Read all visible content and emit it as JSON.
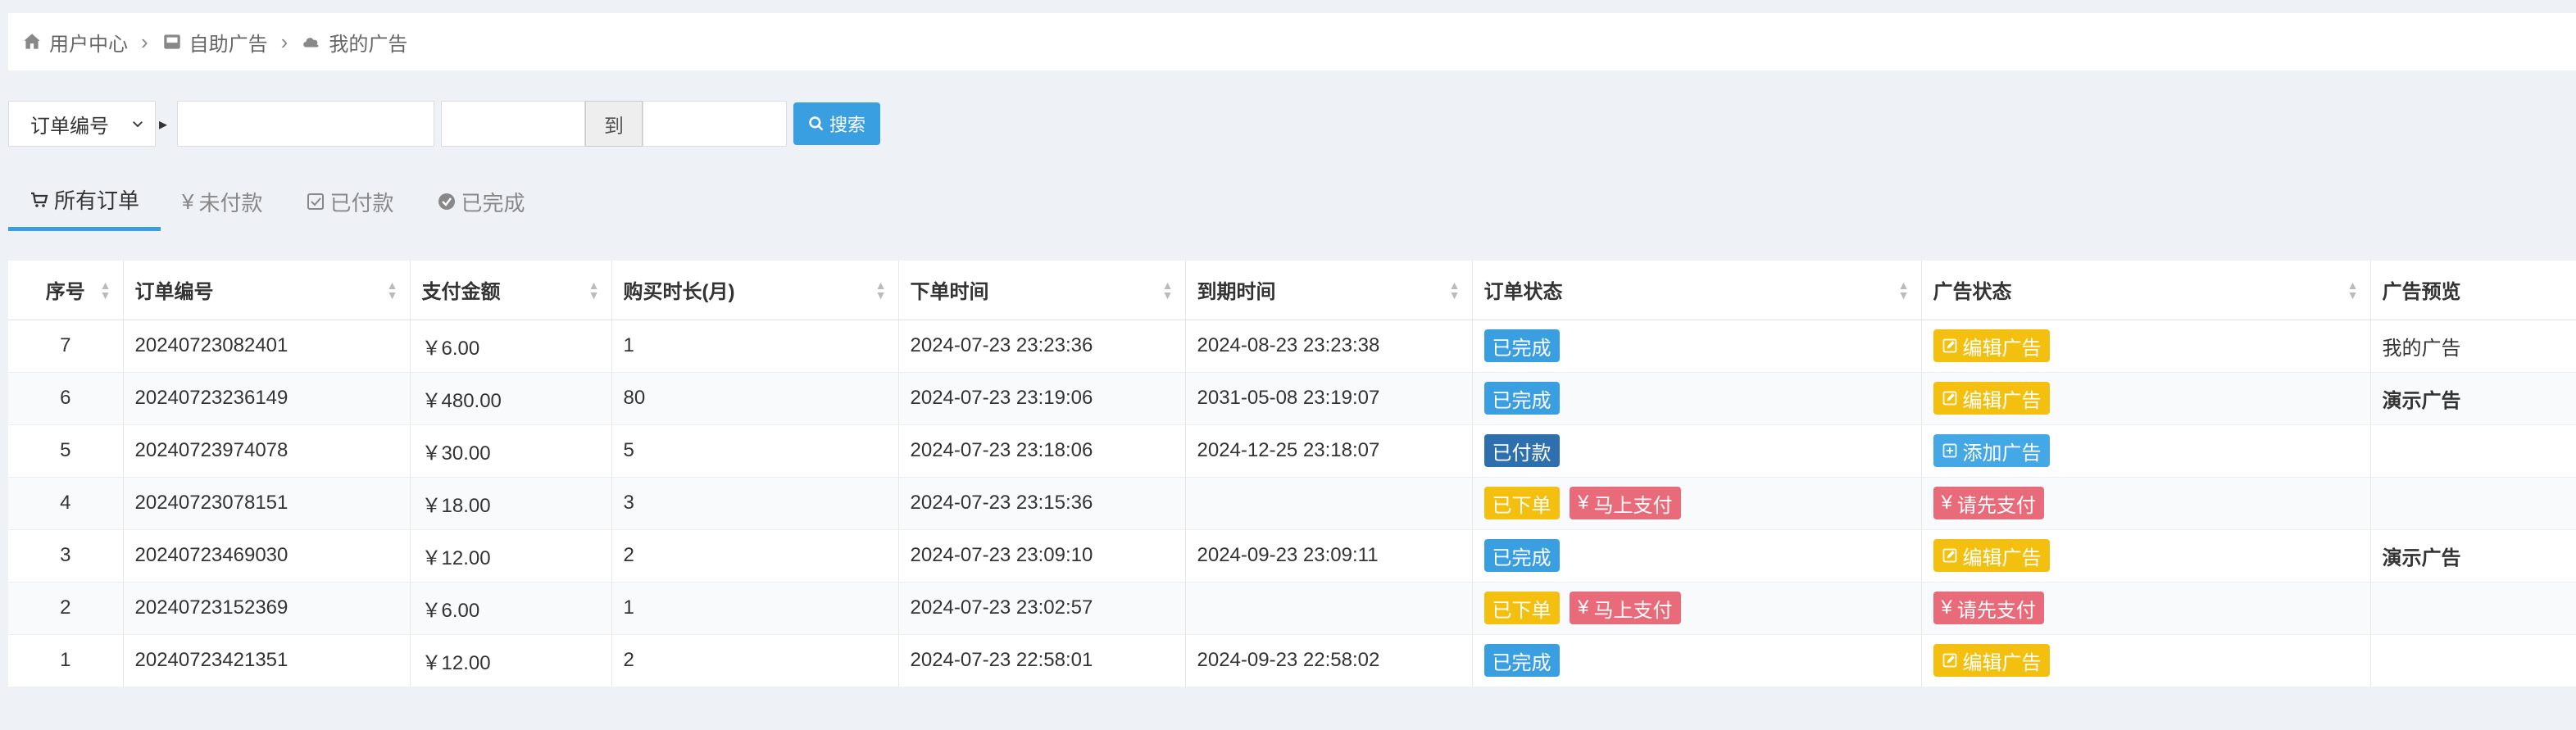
{
  "breadcrumb": {
    "user_center": "用户中心",
    "self_ads": "自助广告",
    "my_ads": "我的广告"
  },
  "search": {
    "field": "订单编号",
    "to": "到",
    "button": "搜索"
  },
  "tabs": {
    "all": "所有订单",
    "unpaid": "未付款",
    "paid": "已付款",
    "done": "已完成"
  },
  "headers": {
    "seq": "序号",
    "order_no": "订单编号",
    "amount": "支付金额",
    "duration": "购买时长(月)",
    "order_time": "下单时间",
    "expire_time": "到期时间",
    "order_status": "订单状态",
    "ad_status": "广告状态",
    "ad_preview": "广告预览"
  },
  "labels": {
    "done": "已完成",
    "paid": "已付款",
    "ordered": "已下单",
    "pay_now": "马上支付",
    "edit_ad": "编辑广告",
    "add_ad": "添加广告",
    "pay_first": "请先支付",
    "currency": "¥",
    "yen_glyph": "¥"
  },
  "rows": [
    {
      "seq": "7",
      "order_no": "20240723082401",
      "amount": "￥6.00",
      "duration": "1",
      "order_time": "2024-07-23 23:23:36",
      "expire_time": "2024-08-23 23:23:38",
      "preview": "我的广告"
    },
    {
      "seq": "6",
      "order_no": "20240723236149",
      "amount": "￥480.00",
      "duration": "80",
      "order_time": "2024-07-23 23:19:06",
      "expire_time": "2031-05-08 23:19:07",
      "preview": "演示广告"
    },
    {
      "seq": "5",
      "order_no": "20240723974078",
      "amount": "￥30.00",
      "duration": "5",
      "order_time": "2024-07-23 23:18:06",
      "expire_time": "2024-12-25 23:18:07",
      "preview": ""
    },
    {
      "seq": "4",
      "order_no": "20240723078151",
      "amount": "￥18.00",
      "duration": "3",
      "order_time": "2024-07-23 23:15:36",
      "expire_time": "",
      "preview": ""
    },
    {
      "seq": "3",
      "order_no": "20240723469030",
      "amount": "￥12.00",
      "duration": "2",
      "order_time": "2024-07-23 23:09:10",
      "expire_time": "2024-09-23 23:09:11",
      "preview": "演示广告"
    },
    {
      "seq": "2",
      "order_no": "20240723152369",
      "amount": "￥6.00",
      "duration": "1",
      "order_time": "2024-07-23 23:02:57",
      "expire_time": "",
      "preview": ""
    },
    {
      "seq": "1",
      "order_no": "20240723421351",
      "amount": "￥12.00",
      "duration": "2",
      "order_time": "2024-07-23 22:58:01",
      "expire_time": "2024-09-23 22:58:02",
      "preview": ""
    }
  ],
  "colors": {
    "primary": "#3a9fe0",
    "warning": "#f4c010",
    "danger": "#e96a78",
    "paid": "#2e6fae"
  },
  "icons": {
    "home": "home-icon",
    "box": "inbox-icon",
    "cloud": "cloud-icon",
    "search": "search-icon",
    "cart": "cart-icon",
    "yen": "yen-icon",
    "check_square": "check-square-icon",
    "check_circle": "check-circle-icon",
    "edit": "edit-icon",
    "plus": "plus-square-icon"
  }
}
